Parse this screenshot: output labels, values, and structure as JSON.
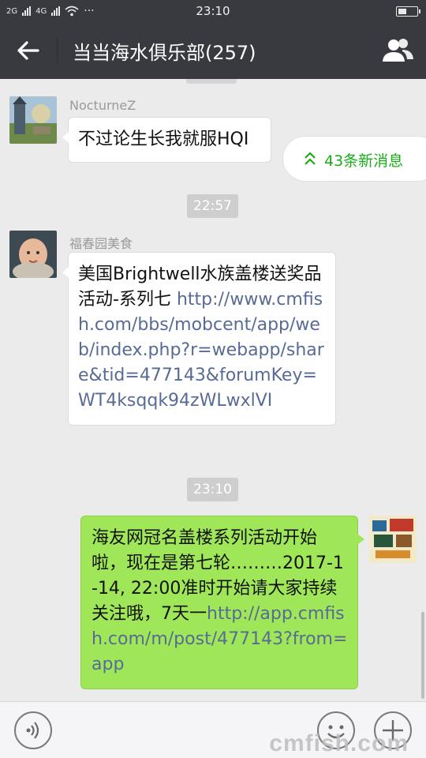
{
  "status_bar": {
    "net1": "2G",
    "net2": "4G",
    "time": "23:10",
    "dots": "···"
  },
  "header": {
    "title": "当当海水俱乐部(257)"
  },
  "new_messages": {
    "label": "43条新消息"
  },
  "messages": [
    {
      "sender": "NocturneZ",
      "text": "不过论生长我就服HQI"
    },
    {
      "sender": "福春园美食",
      "text": "美国Brightwell水族盖楼送奖品活动-系列七 ",
      "link": "http://www.cmfish.com/bbs/mobcent/app/web/index.php?r=webapp/share&tid=477143&forumKey=WT4ksqqk94zWLwxlVI"
    },
    {
      "text": "海友网冠名盖楼系列活动开始啦，现在是第七轮………2017-1-14, 22:00准时开始请大家持续关注哦，7天一",
      "link": "http://app.cmfish.com/m/post/477143?from=app"
    }
  ],
  "time_separators": [
    "22:57",
    "23:10"
  ],
  "watermark": "cmfish.com",
  "colors": {
    "navbar": "#393a3f",
    "self_bubble": "#9fe658",
    "link": "#576b95",
    "new_msg": "#1aad19"
  }
}
